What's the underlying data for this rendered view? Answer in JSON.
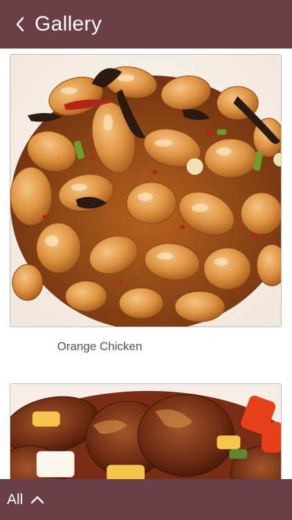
{
  "header": {
    "title": "Gallery"
  },
  "gallery": {
    "items": [
      {
        "caption": "Orange Chicken"
      },
      {
        "caption": ""
      }
    ]
  },
  "filter_bar": {
    "label": "All"
  },
  "colors": {
    "bar_background": "#6a4046",
    "bar_text": "#ffffff",
    "caption_text": "#555555",
    "card_border": "#bdbdbd"
  },
  "icons": {
    "back": "chevron-left-icon",
    "filter_toggle": "chevron-up-icon"
  }
}
